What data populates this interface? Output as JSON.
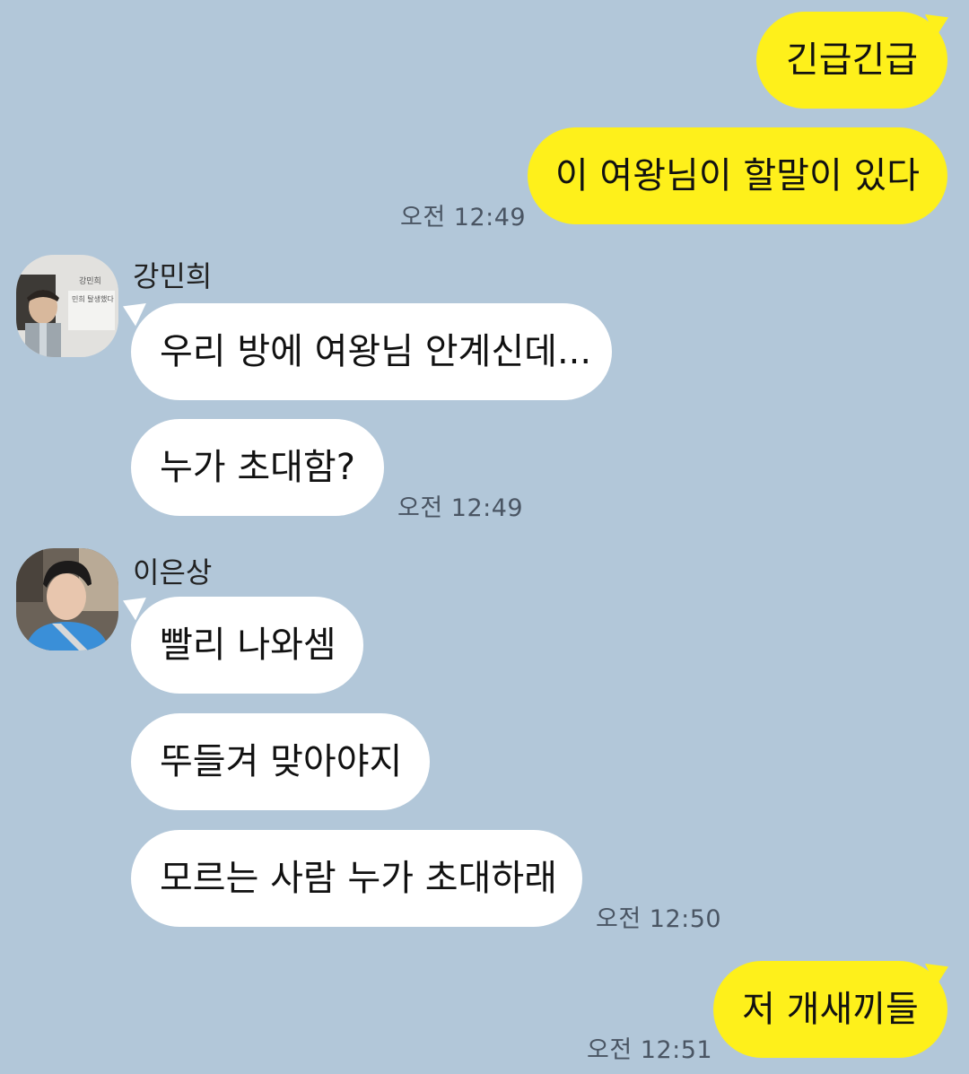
{
  "conversation": {
    "messages": [
      {
        "sender": "me",
        "text": "긴급긴급"
      },
      {
        "sender": "me",
        "text": "이 여왕님이 할말이 있다",
        "time": "오전 12:49"
      },
      {
        "sender": "강민희",
        "text": "우리 방에 여왕님 안계신데..."
      },
      {
        "sender": "강민희",
        "text": "누가 초대함?",
        "time": "오전 12:49"
      },
      {
        "sender": "이은상",
        "text": "빨리 나와셈"
      },
      {
        "sender": "이은상",
        "text": "뚜들겨 맞아야지"
      },
      {
        "sender": "이은상",
        "text": "모르는 사람 누가 초대하래",
        "time": "오전 12:50"
      },
      {
        "sender": "me",
        "text": "저 개새끼들",
        "time": "오전 12:51"
      }
    ],
    "participants": [
      {
        "name": "강민희",
        "avatar_caption": [
          "강민희",
          "민희 탈생했다"
        ]
      },
      {
        "name": "이은상"
      }
    ]
  },
  "colors": {
    "background": "#b2c7d9",
    "my_bubble": "#fef01b",
    "other_bubble": "#ffffff"
  }
}
